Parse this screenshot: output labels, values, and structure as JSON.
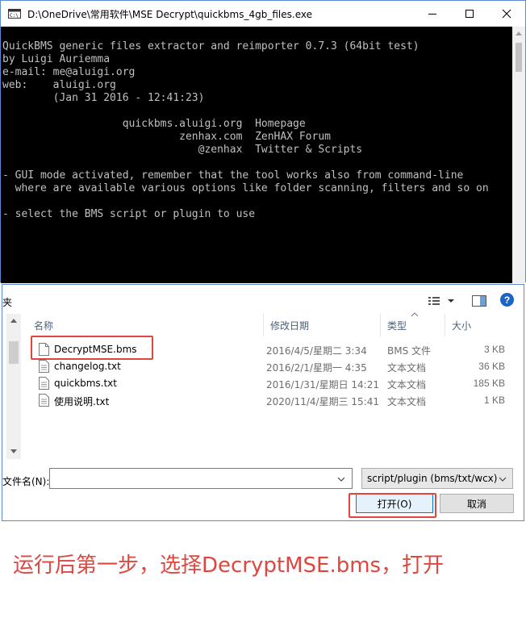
{
  "window": {
    "title": "D:\\OneDrive\\常用软件\\MSE Decrypt\\quickbms_4gb_files.exe"
  },
  "console": {
    "text": "QuickBMS generic files extractor and reimporter 0.7.3 (64bit test)\nby Luigi Auriemma\ne-mail: me@aluigi.org\nweb:    aluigi.org\n        (Jan 31 2016 - 12:41:23)\n\n                   quickbms.aluigi.org  Homepage\n                            zenhax.com  ZenHAX Forum\n                               @zenhax  Twitter & Scripts\n\n- GUI mode activated, remember that the tool works also from command-line\n  where are available various options like folder scanning, filters and so on\n\n- select the BMS script or plugin to use"
  },
  "dialog": {
    "left_label": "夹",
    "columns": {
      "name": "名称",
      "date": "修改日期",
      "type": "类型",
      "size": "大小"
    },
    "files": [
      {
        "name": "DecryptMSE.bms",
        "date": "2016/4/5/星期二 3:34",
        "type": "BMS 文件",
        "size": "3 KB"
      },
      {
        "name": "changelog.txt",
        "date": "2016/2/1/星期一 4:35",
        "type": "文本文档",
        "size": "36 KB"
      },
      {
        "name": "quickbms.txt",
        "date": "2016/1/31/星期日 14:21",
        "type": "文本文档",
        "size": "185 KB"
      },
      {
        "name": "使用说明.txt",
        "date": "2020/11/4/星期三 15:41",
        "type": "文本文档",
        "size": "1 KB"
      }
    ],
    "filename_label": "文件名(N):",
    "filename_value": "",
    "filter_value": "script/plugin (bms/txt/wcx)",
    "open_label": "打开(O)",
    "cancel_label": "取消",
    "help_symbol": "?"
  },
  "caption": "运行后第一步，选择DecryptMSE.bms，打开",
  "colors": {
    "highlight": "#e0463f",
    "accent": "#0078d7",
    "help": "#1a63c7"
  }
}
